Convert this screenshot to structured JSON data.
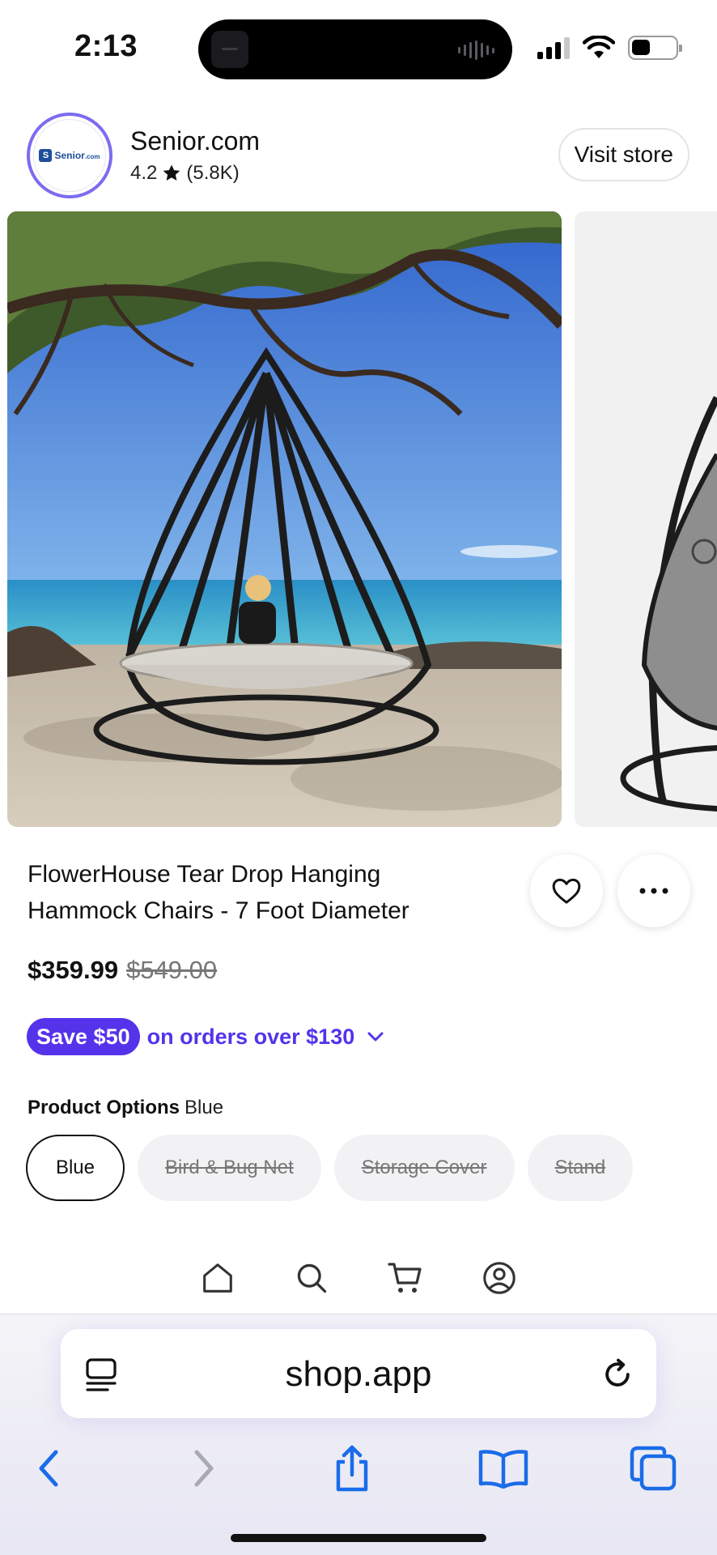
{
  "status_bar": {
    "time": "2:13"
  },
  "store": {
    "name": "Senior.com",
    "rating": "4.2",
    "review_count": "(5.8K)",
    "logo_text": "Senior",
    "logo_suffix": ".com",
    "visit_label": "Visit store"
  },
  "product": {
    "title": "FlowerHouse Tear Drop Hanging Hammock Chairs - 7 Foot Diameter",
    "price": "$359.99",
    "compare_price": "$549.00",
    "promo_badge": "Save $50",
    "promo_text": "on orders over $130",
    "options_label": "Product Options",
    "selected_option": "Blue",
    "options": [
      {
        "label": "Blue",
        "state": "selected"
      },
      {
        "label": "Bird & Bug Net",
        "state": "unavailable"
      },
      {
        "label": "Storage Cover",
        "state": "unavailable"
      },
      {
        "label": "Stand",
        "state": "unavailable"
      }
    ]
  },
  "page_nav": {
    "items": [
      "home-icon",
      "search-icon",
      "cart-icon",
      "account-icon"
    ]
  },
  "browser": {
    "url": "shop.app"
  },
  "colors": {
    "accent": "#5433eb",
    "logo_ring": "#7b6cf0",
    "browser_tint": "#1a6ce8"
  }
}
